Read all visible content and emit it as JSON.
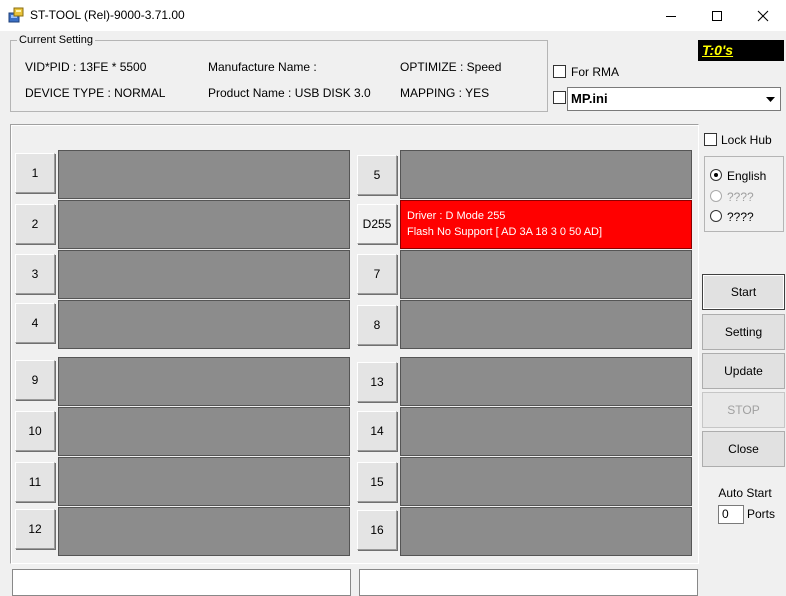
{
  "window": {
    "title": "ST-TOOL (Rel)-9000-3.71.00",
    "icon": "app-icon"
  },
  "current_setting": {
    "legend": "Current Setting",
    "vid_pid": "VID*PID : 13FE * 5500",
    "manufacture": "Manufacture Name :",
    "optimize": "OPTIMIZE : Speed",
    "device_type": "DEVICE TYPE : NORMAL",
    "product": "Product Name : USB DISK 3.0",
    "mapping": "MAPPING : YES"
  },
  "timer": {
    "text": "T:0's",
    "color": "#ffff00"
  },
  "for_rma": {
    "label": "For RMA",
    "checked": false
  },
  "ini_combo": {
    "value": "MP.ini",
    "checked": false
  },
  "lock_hub": {
    "label": "Lock Hub",
    "checked": false
  },
  "language": [
    {
      "label": "English",
      "checked": true,
      "enabled": true
    },
    {
      "label": "????",
      "checked": false,
      "enabled": false
    },
    {
      "label": "????",
      "checked": false,
      "enabled": true
    }
  ],
  "ports": {
    "p1": "1",
    "p2": "2",
    "p3": "3",
    "p4": "4",
    "p5": "5",
    "p6": "D255",
    "p7": "7",
    "p8": "8",
    "p9": "9",
    "p10": "10",
    "p11": "11",
    "p12": "12",
    "p13": "13",
    "p14": "14",
    "p15": "15",
    "p16": "16"
  },
  "slot6": {
    "line1": "Driver : D  Mode 255",
    "line2": "Flash No Support [ AD 3A 18 3 0 50 AD]",
    "color": "#ff0000"
  },
  "buttons": {
    "start": "Start",
    "setting": "Setting",
    "update": "Update",
    "stop": "STOP",
    "close": "Close"
  },
  "auto_start": {
    "label": "Auto Start",
    "value": "0",
    "unit": "Ports"
  }
}
